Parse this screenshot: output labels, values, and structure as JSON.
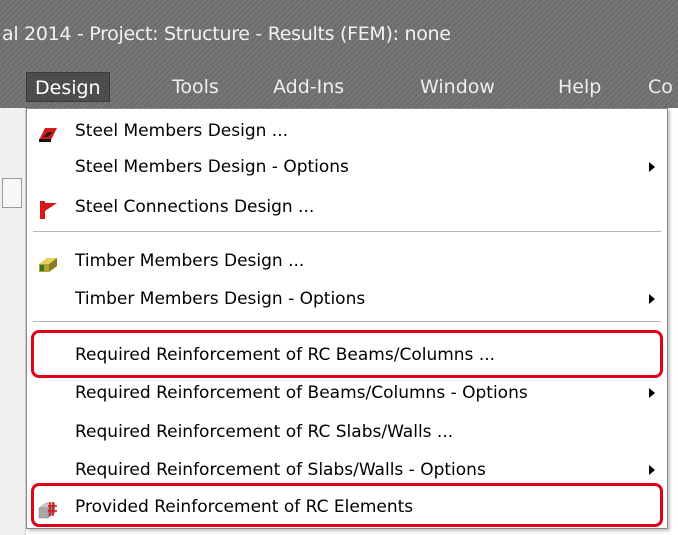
{
  "window": {
    "title": "al 2014 - Project: Structure - Results (FEM): none"
  },
  "menubar": {
    "items": [
      {
        "label": "Design",
        "active": true
      },
      {
        "label": "Tools"
      },
      {
        "label": "Add-Ins"
      },
      {
        "label": "Window"
      },
      {
        "label": "Help"
      },
      {
        "label": "Co"
      }
    ]
  },
  "design_menu": {
    "items": [
      {
        "label": "Steel Members Design ...",
        "icon": "steel-members-icon",
        "submenu": false
      },
      {
        "label": "Steel Members Design - Options",
        "submenu": true
      },
      {
        "label": "Steel Connections Design ...",
        "icon": "steel-connections-icon",
        "submenu": false
      },
      {
        "label": "Timber Members Design ...",
        "icon": "timber-members-icon",
        "submenu": false
      },
      {
        "label": "Timber Members Design - Options",
        "submenu": true
      },
      {
        "label": "Required Reinforcement of RC Beams/Columns ...",
        "submenu": false,
        "highlighted": true
      },
      {
        "label": "Required Reinforcement of Beams/Columns - Options",
        "submenu": true
      },
      {
        "label": "Required Reinforcement of RC Slabs/Walls ...",
        "submenu": false
      },
      {
        "label": "Required Reinforcement of Slabs/Walls - Options",
        "submenu": true
      },
      {
        "label": "Provided Reinforcement of RC Elements",
        "icon": "provided-reinforcement-icon",
        "submenu": false,
        "highlighted": true
      }
    ]
  },
  "colors": {
    "highlight": "#e0001b",
    "menubar": "#707070",
    "menu_active": "#4d4d4d"
  }
}
